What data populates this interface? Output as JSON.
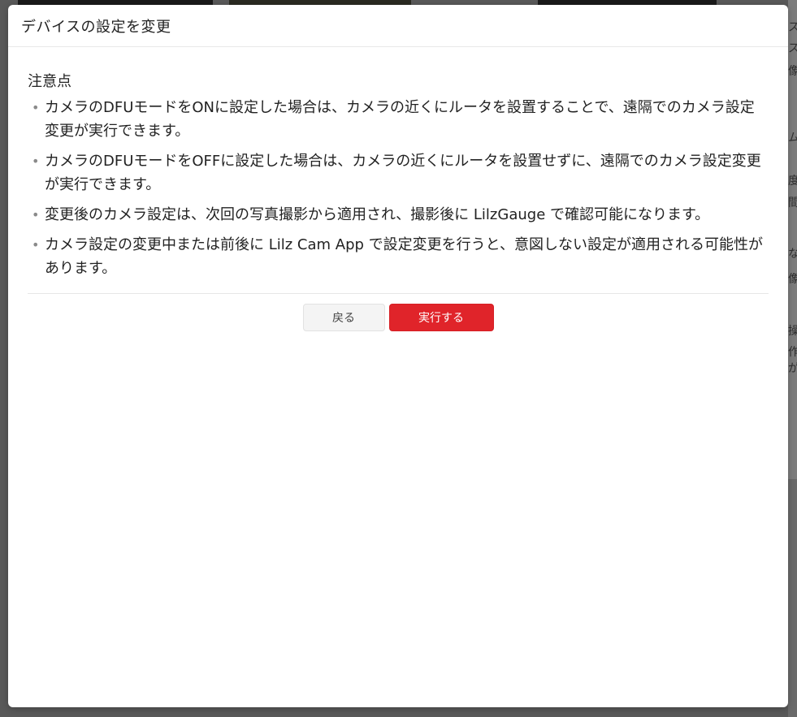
{
  "modal": {
    "title": "デバイスの設定を変更",
    "notice_heading": "注意点",
    "bullet_char": "•",
    "notices": [
      "カメラのDFUモードをONに設定した場合は、カメラの近くにルータを設置することで、遠隔でのカメラ設定変更が実行できます。",
      "カメラのDFUモードをOFFに設定した場合は、カメラの近くにルータを設置せずに、遠隔でのカメラ設定変更が実行できます。",
      "変更後のカメラ設定は、次回の写真撮影から適用され、撮影後に LilzGauge で確認可能になります。",
      "カメラ設定の変更中または前後に Lilz Cam App で設定変更を行うと、意図しない設定が適用される可能性があります。"
    ],
    "buttons": {
      "back_label": "戻る",
      "execute_label": "実行する"
    }
  },
  "background": {
    "side_glyphs": [
      "ス",
      "ス",
      "像",
      "ム",
      "度",
      "間",
      "な",
      "像",
      "操",
      "作",
      "が"
    ]
  },
  "colors": {
    "accent": "#e0242a",
    "overlay": "#595959",
    "bullet": "#8a8a8a"
  }
}
